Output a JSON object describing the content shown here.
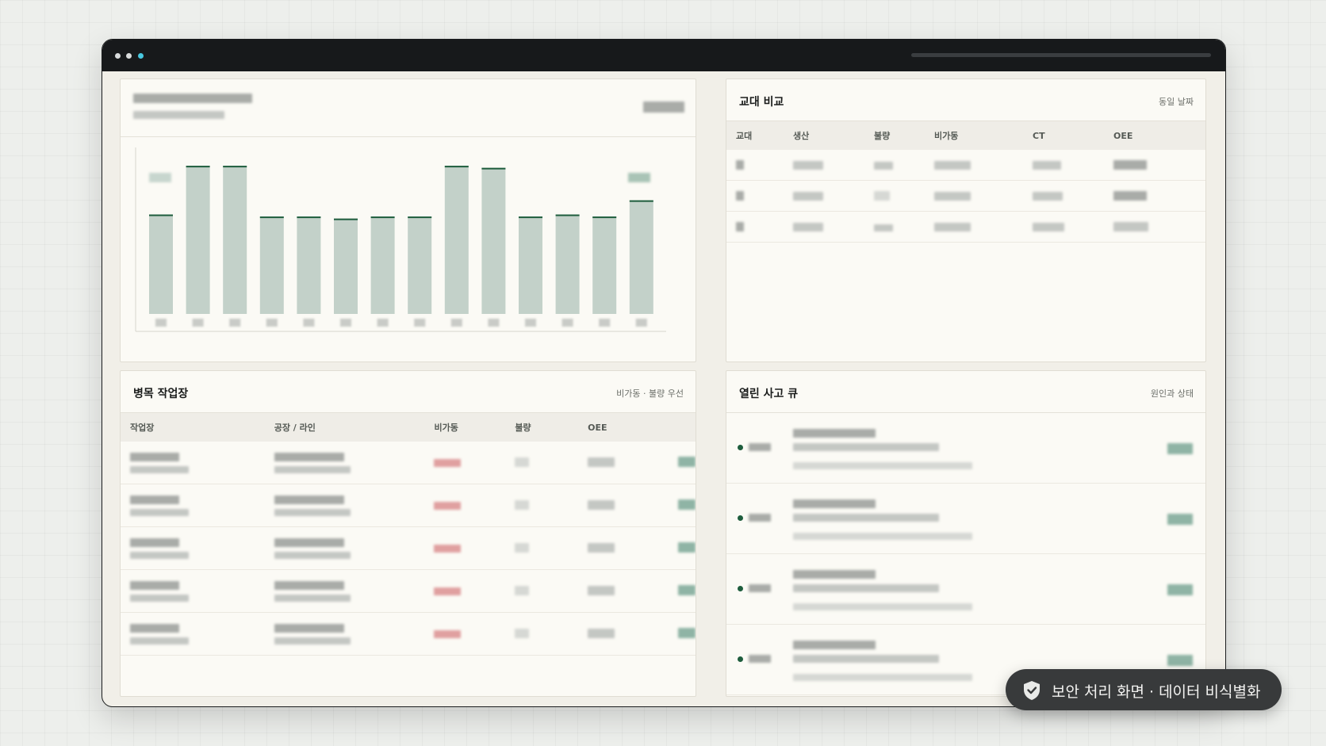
{
  "window": {
    "accent": "#48c8e0"
  },
  "chart_panel": {
    "title_redacted": true,
    "chart_data": {
      "type": "bar",
      "categories_redacted": true,
      "values": [
        49,
        73,
        73,
        48,
        48,
        47,
        48,
        48,
        73,
        72,
        48,
        49,
        48,
        56
      ],
      "ylim": [
        0,
        100
      ],
      "grid": false,
      "bar_color": "#c3d1c9",
      "cap_color": "#1e5d3d"
    }
  },
  "shift_panel": {
    "title": "교대 비교",
    "subtitle": "동일 날짜",
    "columns": [
      "교대",
      "생산",
      "불량",
      "비가동",
      "CT",
      "OEE"
    ],
    "row_count": 3
  },
  "workcenter_panel": {
    "title": "병목 작업장",
    "subtitle": "비가동 · 불량 우선",
    "columns": [
      "작업장",
      "공장 / 라인",
      "비가동",
      "불량",
      "OEE",
      ""
    ],
    "row_count": 5
  },
  "incident_panel": {
    "title": "열린 사고 큐",
    "subtitle": "원인과 상태",
    "row_count": 4
  },
  "security_badge": {
    "label": "보안 처리 화면 · 데이터 비식별화",
    "icon": "shield-check-icon"
  }
}
